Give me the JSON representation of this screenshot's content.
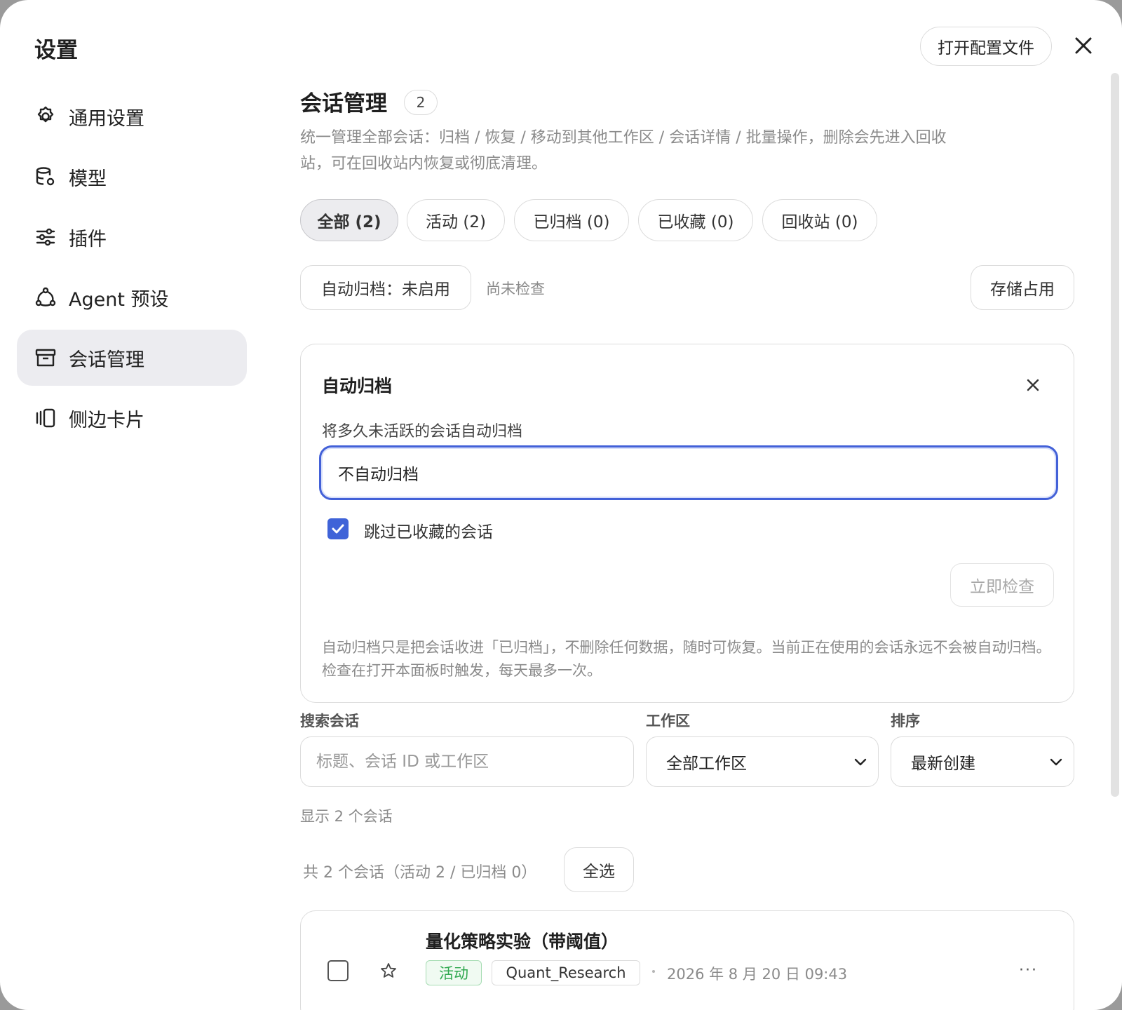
{
  "header": {
    "title": "设置",
    "open_config_label": "打开配置文件",
    "close_icon": "close-icon"
  },
  "sidebar": {
    "items": [
      {
        "label": "通用设置",
        "icon": "gear-icon",
        "active": false
      },
      {
        "label": "模型",
        "icon": "database-gear-icon",
        "active": false
      },
      {
        "label": "插件",
        "icon": "sliders-icon",
        "active": false
      },
      {
        "label": "Agent 预设",
        "icon": "agent-icon",
        "active": false
      },
      {
        "label": "会话管理",
        "icon": "archive-box-icon",
        "active": true
      },
      {
        "label": "侧边卡片",
        "icon": "side-card-icon",
        "active": false
      }
    ]
  },
  "main": {
    "title": "会话管理",
    "count": "2",
    "description": "统一管理全部会话：归档 / 恢复 / 移动到其他工作区 / 会话详情 / 批量操作，删除会先进入回收站，可在回收站内恢复或彻底清理。",
    "tabs": [
      {
        "label": "全部 (2)",
        "active": true
      },
      {
        "label": "活动 (2)",
        "active": false
      },
      {
        "label": "已归档 (0)",
        "active": false
      },
      {
        "label": "已收藏 (0)",
        "active": false
      },
      {
        "label": "回收站 (0)",
        "active": false
      }
    ],
    "auto_archive_status": "自动归档：未启用",
    "status_note": "尚未检查",
    "storage_button": "存储占用",
    "auto_archive_panel": {
      "title": "自动归档",
      "field_label": "将多久未活跃的会话自动归档",
      "field_value": "不自动归档",
      "skip_starred_label": "跳过已收藏的会话",
      "skip_starred_checked": true,
      "check_now_button": "立即检查",
      "note": "自动归档只是把会话收进「已归档」，不删除任何数据，随时可恢复。当前正在使用的会话永远不会被自动归档。检查在打开本面板时触发，每天最多一次。"
    },
    "filters": {
      "search_label": "搜索会话",
      "search_placeholder": "标题、会话 ID 或工作区",
      "workspace_label": "工作区",
      "workspace_value": "全部工作区",
      "sort_label": "排序",
      "sort_value": "最新创建"
    },
    "showing": "显示 2 个会话",
    "total_summary": "共 2 个会话（活动 2 / 已归档 0）",
    "select_all_button": "全选",
    "conversations": [
      {
        "title": "量化策略实验（带阈值）",
        "status": "活动",
        "workspace": "Quant_Research",
        "time": "2026 年 8 月 20 日 09:43",
        "more": "···"
      }
    ]
  },
  "colors": {
    "accent": "#3f63d8",
    "active_green": "#2fa84f",
    "muted_text": "#8a8a8a",
    "border": "#dcdcdc",
    "active_bg": "#ececf0"
  }
}
